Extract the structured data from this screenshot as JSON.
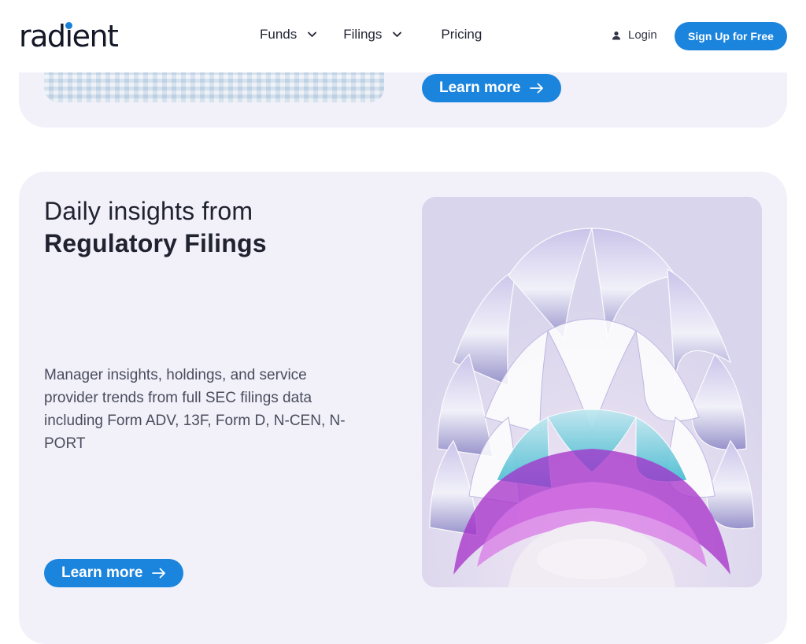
{
  "header": {
    "logo_text": "radient",
    "nav": [
      {
        "label": "Funds",
        "has_dropdown": true
      },
      {
        "label": "Filings",
        "has_dropdown": true
      },
      {
        "label": "Pricing",
        "has_dropdown": false
      }
    ],
    "login_label": "Login",
    "signup_label": "Sign Up for Free"
  },
  "top_card": {
    "learn_more_label": "Learn more"
  },
  "main_card": {
    "title_line1": "Daily insights from",
    "title_line2": "Regulatory Filings",
    "description": "Manager insights, holdings, and service provider trends from full SEC filings data including Form ADV, 13F, Form D, N-CEN, N-PORT",
    "learn_more_label": "Learn more"
  },
  "colors": {
    "accent": "#1b84dd",
    "card_bg": "#f2f1fa",
    "text_dark": "#20222f",
    "logo_dot": "#1a82d6"
  },
  "icons": {
    "nav_dropdown": "chevron-down-icon",
    "login": "user-icon",
    "learn_more": "arrow-right-icon"
  }
}
